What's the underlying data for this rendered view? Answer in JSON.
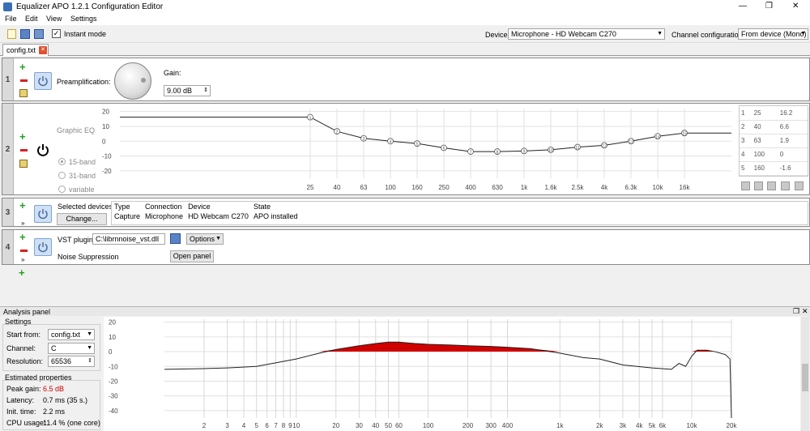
{
  "window": {
    "title": "Equalizer APO 1.2.1 Configuration Editor",
    "controls": [
      "—",
      "❐",
      "✕"
    ]
  },
  "menu": [
    "File",
    "Edit",
    "View",
    "Settings"
  ],
  "toolbar": {
    "instant_mode_label": "Instant mode",
    "instant_mode_checked": true,
    "device_label": "Device:",
    "device_value": "Microphone - HD Webcam C270",
    "channel_config_label": "Channel configuration:",
    "channel_config_value": "From device (Mono)"
  },
  "tabs": [
    {
      "label": "config.txt",
      "close": "✕"
    }
  ],
  "rows": {
    "r1": {
      "num": "1",
      "preamp_label": "Preamplification:",
      "gain_label": "Gain:",
      "gain_value": "9.00 dB"
    },
    "r2": {
      "num": "2",
      "geq_label": "Graphic EQ:",
      "bands": [
        "15-band",
        "31-band",
        "variable"
      ],
      "selected_band": "15-band",
      "y_ticks": [
        "20",
        "10",
        "0",
        "-10",
        "-20"
      ],
      "x_ticks": [
        "25",
        "40",
        "63",
        "100",
        "160",
        "250",
        "400",
        "630",
        "1k",
        "1.6k",
        "2.5k",
        "4k",
        "6.3k",
        "10k",
        "16k"
      ],
      "table": [
        [
          "1",
          "25",
          "16.2"
        ],
        [
          "2",
          "40",
          "6.6"
        ],
        [
          "3",
          "63",
          "1.9"
        ],
        [
          "4",
          "100",
          "0"
        ],
        [
          "5",
          "160",
          "-1.6"
        ]
      ]
    },
    "r3": {
      "num": "3",
      "selected_devices_label": "Selected devices:",
      "change_button": "Change...",
      "headers": [
        "Type",
        "Connection",
        "Device",
        "State"
      ],
      "cells": [
        "Capture",
        "Microphone",
        "HD Webcam C270",
        "APO installed"
      ]
    },
    "r4": {
      "num": "4",
      "vst_label": "VST plugin:",
      "vst_path": "C:\\librnnoise_vst.dll",
      "options_button": "Options",
      "plugin_name": "Noise Suppression",
      "open_panel_button": "Open panel"
    }
  },
  "analysis": {
    "title": "Analysis panel",
    "settings_header": "Settings",
    "start_from_label": "Start from:",
    "start_from_value": "config.txt",
    "channel_label": "Channel:",
    "channel_value": "C",
    "resolution_label": "Resolution:",
    "resolution_value": "65536",
    "estimated_header": "Estimated properties",
    "peak_gain_label": "Peak gain:",
    "peak_gain_value": "6.5 dB",
    "latency_label": "Latency:",
    "latency_value": "0.7 ms (35 s.)",
    "init_time_label": "Init. time:",
    "init_time_value": "2.2 ms",
    "cpu_label": "CPU usage:",
    "cpu_value": "11.4 % (one core)",
    "y_ticks": [
      "20",
      "10",
      "0",
      "-10",
      "-20",
      "-30",
      "-40"
    ],
    "x_ticks": [
      "2",
      "3",
      "4",
      "5",
      "6",
      "7",
      "8",
      "9",
      "10",
      "20",
      "30",
      "40",
      "50",
      "60",
      "100",
      "200",
      "300",
      "400",
      "1k",
      "2k",
      "3k",
      "4k",
      "5k",
      "6k",
      "10k",
      "20k"
    ]
  },
  "colors": {
    "accent_red": "#d00000",
    "peak_text": "#cc0000",
    "grid": "#d0d0d0"
  },
  "chart_data": [
    {
      "type": "line",
      "x": [
        25,
        40,
        63,
        100,
        160,
        250,
        400,
        630,
        1000,
        1600,
        2500,
        4000,
        6300,
        10000,
        16000
      ],
      "values": [
        16.2,
        6.6,
        1.9,
        0,
        -1.6,
        -4.5,
        -7,
        -7,
        -6.6,
        -5.8,
        -4,
        -2.8,
        0,
        3.3,
        5.5
      ],
      "ylim": [
        -25,
        22
      ]
    },
    {
      "type": "area",
      "x": [
        1,
        2,
        3,
        5,
        10,
        15,
        20,
        30,
        40,
        50,
        60,
        80,
        100,
        150,
        200,
        300,
        400,
        600,
        1000,
        1500,
        2000,
        3000,
        5000,
        7000,
        8000,
        9000,
        10000,
        11000,
        13000,
        15000,
        18000,
        19500,
        20000
      ],
      "values": [
        -12,
        -11.5,
        -11,
        -10,
        -5,
        -1,
        1.5,
        4,
        5.5,
        6.5,
        6.5,
        5.5,
        5,
        4.5,
        4,
        3.5,
        3,
        2,
        -1,
        -4,
        -5,
        -9,
        -11,
        -12,
        -8,
        -10,
        -3,
        1,
        1,
        0,
        -2,
        -5,
        -45
      ],
      "ylim": [
        -45,
        22
      ]
    }
  ]
}
